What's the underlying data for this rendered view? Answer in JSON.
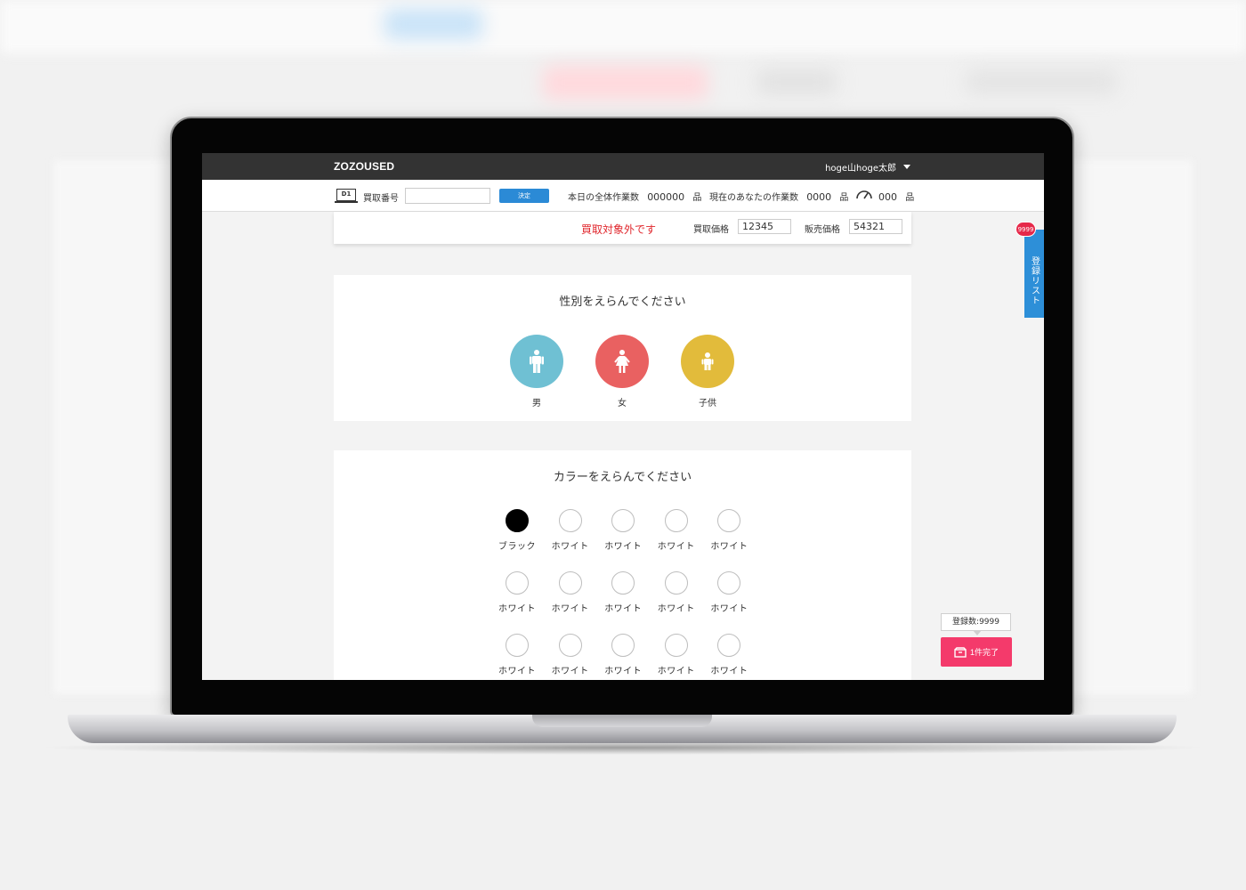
{
  "app": {
    "logo": "ZOZOUSED",
    "user_name": "hoge山hoge太郎"
  },
  "toolbar": {
    "device_code": "D1",
    "kaitori_label": "買取番号",
    "kaitori_value": "",
    "decide_label": "決定",
    "today_total_label": "本日の全体作業数",
    "today_total_value": "000000",
    "my_count_label": "現在のあなたの作業数",
    "my_count_value": "0000",
    "speed_value": "000",
    "unit": "品"
  },
  "price_bar": {
    "status": "買取対象外です",
    "buy_price_label": "買取価格",
    "buy_price_value": "12345",
    "sell_price_label": "販売価格",
    "sell_price_value": "54321"
  },
  "gender": {
    "title": "性別をえらんでください",
    "options": [
      {
        "label": "男",
        "color": "#6fc0d3",
        "icon": "male-icon"
      },
      {
        "label": "女",
        "color": "#e96161",
        "icon": "female-icon"
      },
      {
        "label": "子供",
        "color": "#e2bb3b",
        "icon": "child-icon"
      }
    ]
  },
  "color": {
    "title": "カラーをえらんでください",
    "options": [
      {
        "label": "ブラック",
        "color": "#000000"
      },
      {
        "label": "ホワイト",
        "color": "#ffffff"
      },
      {
        "label": "ホワイト",
        "color": "#ffffff"
      },
      {
        "label": "ホワイト",
        "color": "#ffffff"
      },
      {
        "label": "ホワイト",
        "color": "#ffffff"
      },
      {
        "label": "ホワイト",
        "color": "#ffffff"
      },
      {
        "label": "ホワイト",
        "color": "#ffffff"
      },
      {
        "label": "ホワイト",
        "color": "#ffffff"
      },
      {
        "label": "ホワイト",
        "color": "#ffffff"
      },
      {
        "label": "ホワイト",
        "color": "#ffffff"
      },
      {
        "label": "ホワイト",
        "color": "#ffffff"
      },
      {
        "label": "ホワイト",
        "color": "#ffffff"
      },
      {
        "label": "ホワイト",
        "color": "#ffffff"
      },
      {
        "label": "ホワイト",
        "color": "#ffffff"
      },
      {
        "label": "ホワイト",
        "color": "#ffffff"
      }
    ]
  },
  "side": {
    "badge": "9999",
    "tab_label": "登録リスト"
  },
  "completion": {
    "count_label": "登録数:9999",
    "button_label": "1件完了"
  }
}
